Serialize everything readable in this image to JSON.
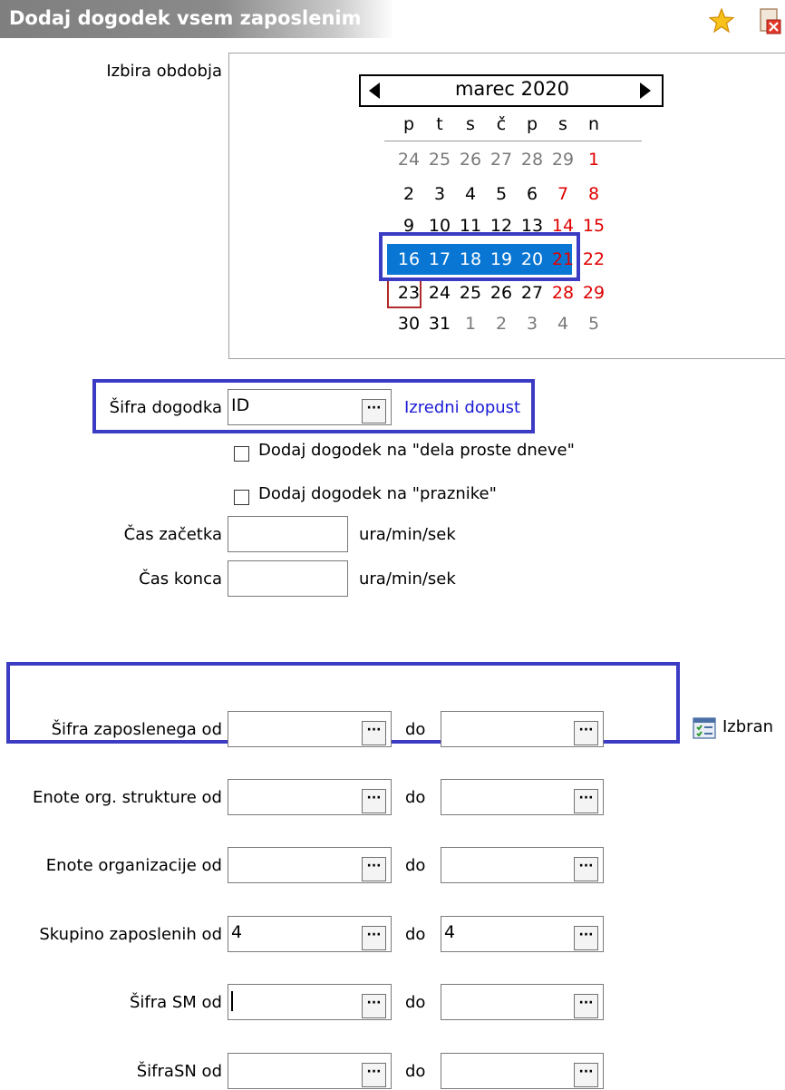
{
  "window": {
    "title": "Dodaj dogodek vsem zaposlenim"
  },
  "period": {
    "label": "Izbira obdobja",
    "month_label": "marec 2020",
    "weekdays": [
      "p",
      "t",
      "s",
      "č",
      "p",
      "s",
      "n"
    ],
    "weeks": [
      [
        "24",
        "25",
        "26",
        "27",
        "28",
        "29",
        "1"
      ],
      [
        "2",
        "3",
        "4",
        "5",
        "6",
        "7",
        "8"
      ],
      [
        "9",
        "10",
        "11",
        "12",
        "13",
        "14",
        "15"
      ],
      [
        "16",
        "17",
        "18",
        "19",
        "20",
        "21",
        "22"
      ],
      [
        "23",
        "24",
        "25",
        "26",
        "27",
        "28",
        "29"
      ],
      [
        "30",
        "31",
        "1",
        "2",
        "3",
        "4",
        "5"
      ]
    ],
    "selected_range": [
      "16",
      "20"
    ],
    "today": "23"
  },
  "event_code": {
    "label": "Šifra dogodka",
    "value": "ID",
    "description": "Izredni dopust"
  },
  "options": {
    "free_days": "Dodaj dogodek na \"dela proste dneve\"",
    "holidays": "Dodaj dogodek na \"praznike\""
  },
  "start_time": {
    "label": "Čas začetka",
    "value": "",
    "unit": "ura/min/sek"
  },
  "end_time": {
    "label": "Čas konca",
    "value": "",
    "unit": "ura/min/sek"
  },
  "to_label": "do",
  "selected_label": "Izbran",
  "filters": [
    {
      "label": "Šifra zaposlenega od",
      "from": "",
      "to": ""
    },
    {
      "label": "Enote org. strukture od",
      "from": "",
      "to": ""
    },
    {
      "label": "Enote organizacije od",
      "from": "",
      "to": ""
    },
    {
      "label": "Skupino zaposlenih  od",
      "from": "4",
      "to": "4"
    },
    {
      "label": "Šifra SM od",
      "from": "",
      "to": ""
    },
    {
      "label": "ŠifraSN od",
      "from": "",
      "to": ""
    }
  ]
}
